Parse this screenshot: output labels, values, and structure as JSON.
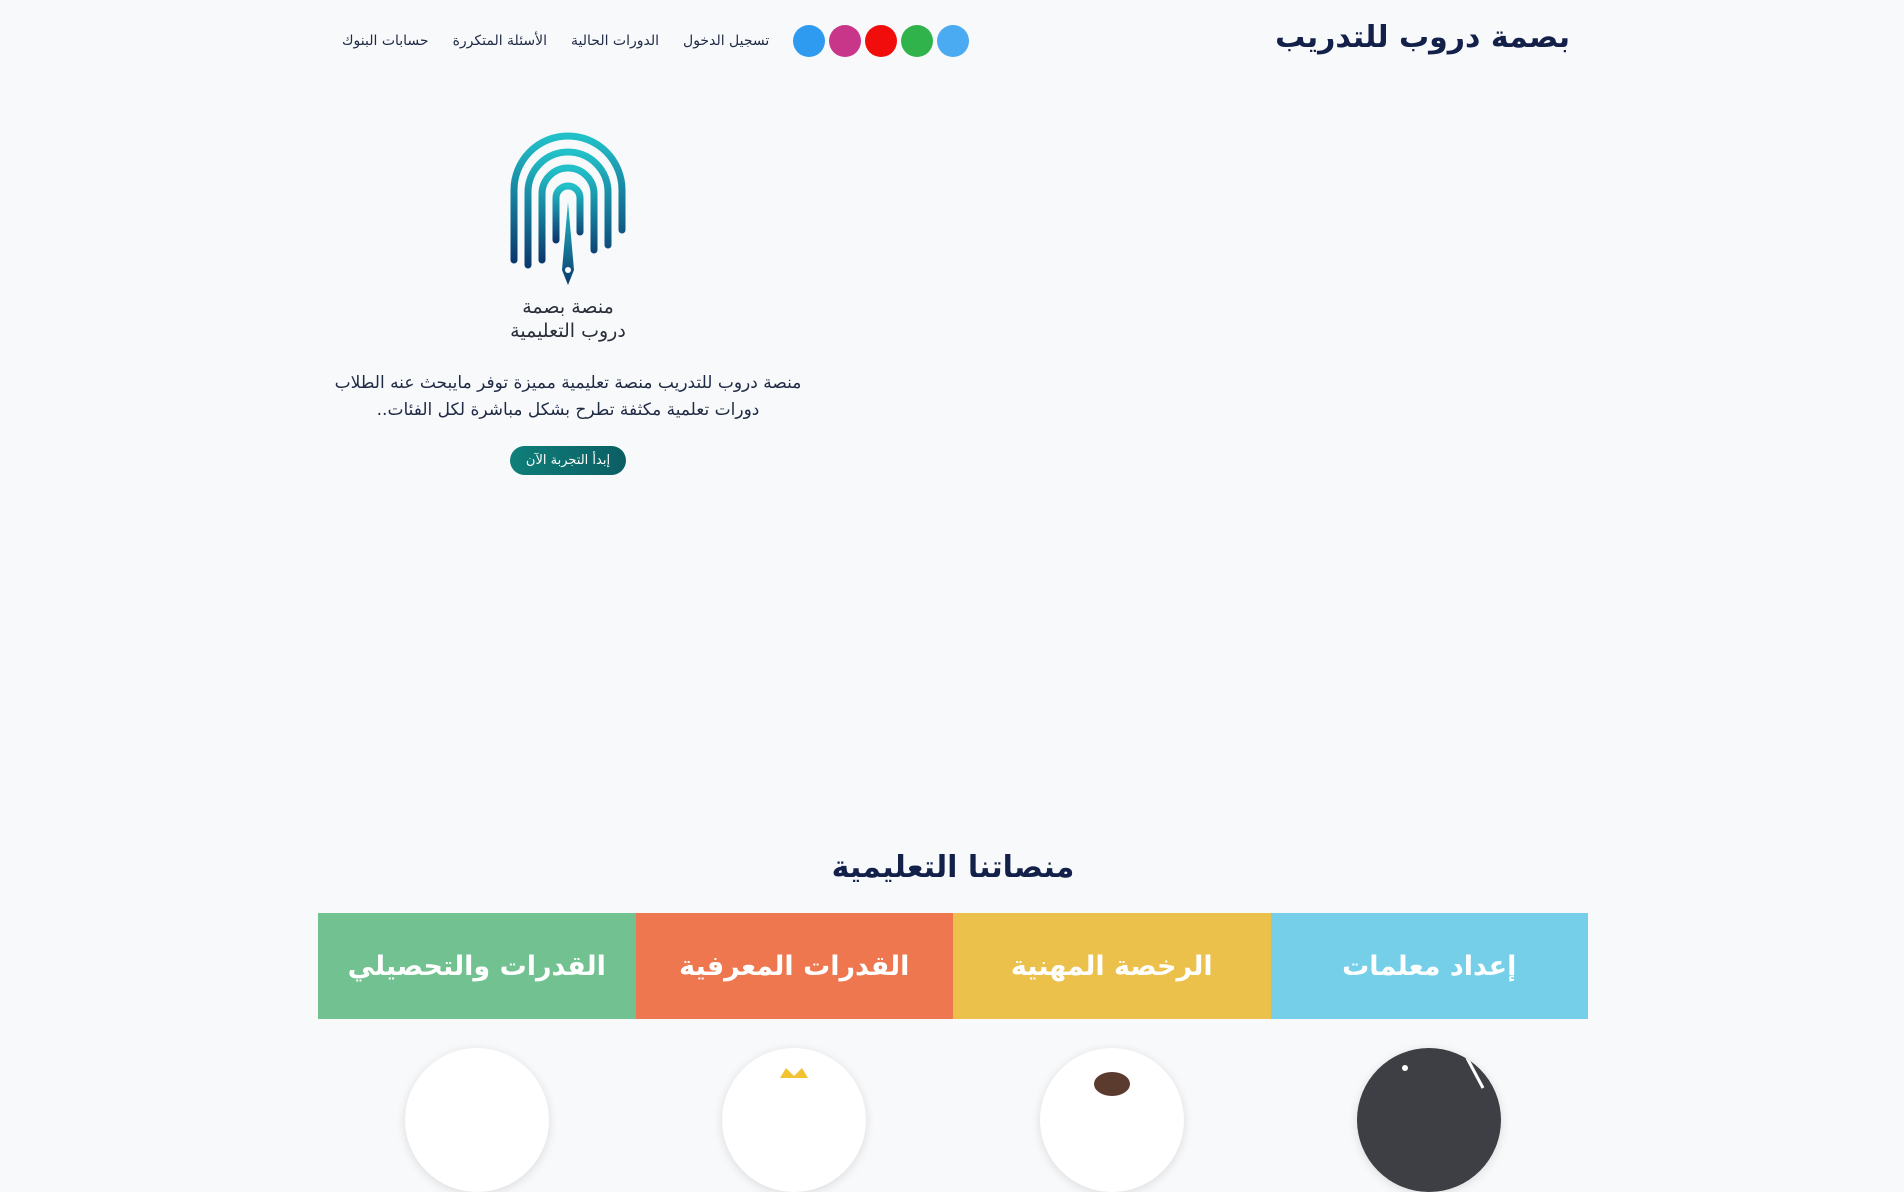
{
  "header": {
    "brand": "بصمة دروب للتدريب",
    "nav": [
      "حسابات البنوك",
      "الأسئلة المتكررة",
      "الدورات الحالية",
      "تسجيل الدخول"
    ],
    "socials": [
      {
        "icon": "twitter-icon",
        "color": "#2f9bf0"
      },
      {
        "icon": "instagram-icon",
        "color": "#c8368a"
      },
      {
        "icon": "youtube-icon",
        "color": "#f20d0d"
      },
      {
        "icon": "whatsapp-icon",
        "color": "#2fb34a"
      },
      {
        "icon": "telegram-icon",
        "color": "#4aaaf2"
      }
    ]
  },
  "hero": {
    "logo_line1": "منصة بصمة",
    "logo_line2": "دروب التعليمية",
    "description": "منصة دروب للتدريب منصة تعليمية مميزة توفر مايبحث عنه الطلاب دورات تعلمية مكثفة تطرح بشكل مباشرة لكل الفئات..",
    "cta": "إبدأ التجربة الآن"
  },
  "platforms_section": {
    "title": "منصاتنا التعليمية",
    "items": [
      {
        "label": "القدرات والتحصيلي",
        "color": "#72c291"
      },
      {
        "label": "القدرات المعرفية",
        "color": "#ee774f"
      },
      {
        "label": "الرخصة المهنية",
        "color": "#ebc04b"
      },
      {
        "label": "إعداد معلمات",
        "color": "#75cfe8"
      }
    ]
  }
}
